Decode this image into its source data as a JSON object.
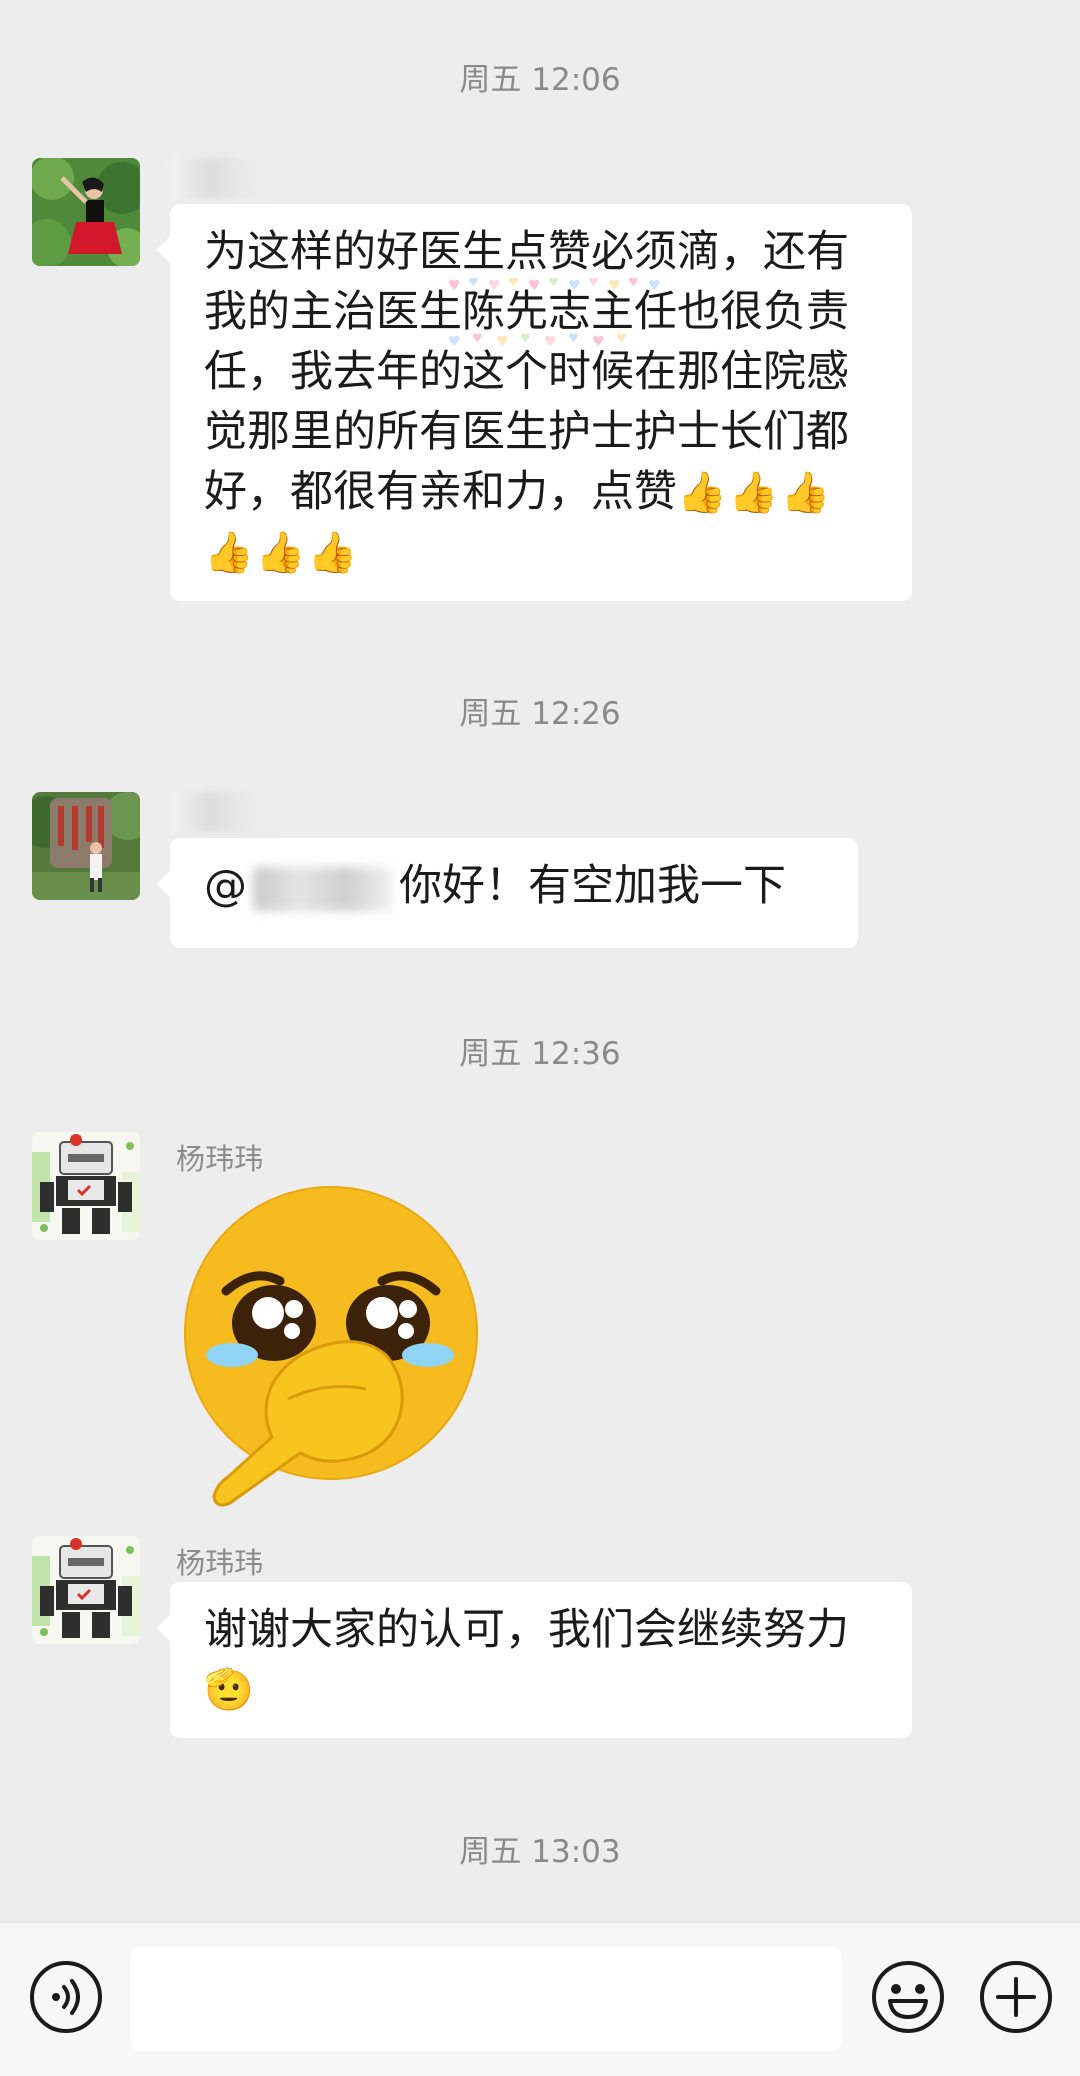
{
  "timestamps": [
    "周五 12:06",
    "周五 12:26",
    "周五 12:36",
    "周五 13:03"
  ],
  "messages": [
    {
      "text": "为这样的好医生点赞必须滴，还有我的主治医生陈先志主任也很负责任，我去年的这个时候在那住院感觉那里的所有医生护士护士长们都好，都很有亲和力，点赞",
      "line1": "为这样的好医生点赞必须滴，还有",
      "line2": "我的主治医生陈先志主任也很负责",
      "line3": "任，我去年的这个时候在那住院感",
      "line4": "觉那里的所有医生护士护士长们都",
      "line5": "好，都很有亲和力，点赞",
      "emoji_tail_a": "👍👍👍",
      "emoji_tail_b": "👍👍👍"
    },
    {
      "at": "@",
      "text": "你好！有空加我一下"
    },
    {
      "sender": "杨玮玮",
      "sticker": "crying-face-hand-over-mouth-sticker"
    },
    {
      "sender": "杨玮玮",
      "line1": "谢谢大家的认可，我们会继续努力",
      "emoji_tail": "🫡"
    }
  ],
  "input_bar": {
    "voice_icon": "voice-icon",
    "emoji_icon": "smiley-icon",
    "plus_icon": "plus-icon",
    "value": ""
  },
  "colors": {
    "background": "#ededed",
    "bubble": "#ffffff",
    "timestamp": "#8a8a8a"
  }
}
